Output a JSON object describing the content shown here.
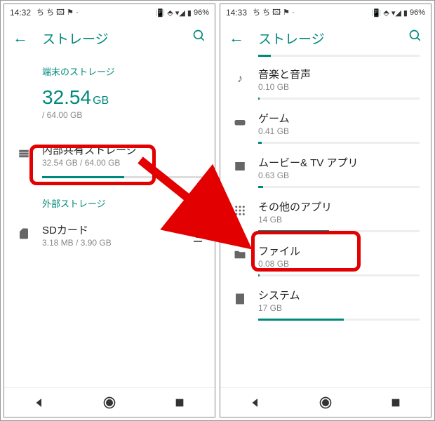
{
  "statusbar": {
    "time_left": "14:32",
    "time_right": "14:33",
    "battery": "96%"
  },
  "appbar": {
    "title": "ストレージ"
  },
  "left": {
    "section1": "端末のストレージ",
    "big_value": "32.54",
    "big_unit": "GB",
    "big_total": "/ 64.00 GB",
    "internal_label": "内部共有ストレージ",
    "internal_sub": "32.54 GB / 64.00 GB",
    "internal_fill": 51,
    "section2": "外部ストレージ",
    "sd_label": "SDカード",
    "sd_sub": "3.18 MB / 3.90 GB"
  },
  "right": {
    "items": [
      {
        "label": "音楽と音声",
        "sub": "0.10 GB",
        "fill": 1
      },
      {
        "label": "ゲーム",
        "sub": "0.41 GB",
        "fill": 2
      },
      {
        "label": "ムービー& TV アプリ",
        "sub": "0.63 GB",
        "fill": 3
      },
      {
        "label": "その他のアプリ",
        "sub": "14 GB",
        "fill": 44
      },
      {
        "label": "ファイル",
        "sub": "0.08 GB",
        "fill": 1
      },
      {
        "label": "システム",
        "sub": "17 GB",
        "fill": 53
      }
    ]
  }
}
